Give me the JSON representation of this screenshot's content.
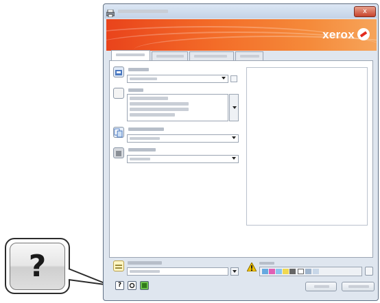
{
  "banner": {
    "brand": "xerox"
  },
  "titlebar": {
    "close_glyph": "x"
  },
  "callout": {
    "symbol": "?"
  },
  "bottom": {
    "help_button_glyph": "?"
  },
  "colors": {
    "banner_start": "#e9431b",
    "banner_end": "#f6a45a",
    "window_frame": "#dfe6ef"
  },
  "icons": [
    "printer-icon",
    "paper-tray-icon",
    "sides-icon",
    "color-mode-icon",
    "presets-icon",
    "warning-icon",
    "help-icon",
    "restore-defaults-icon",
    "status-icon",
    "xerox-logo-icon"
  ]
}
